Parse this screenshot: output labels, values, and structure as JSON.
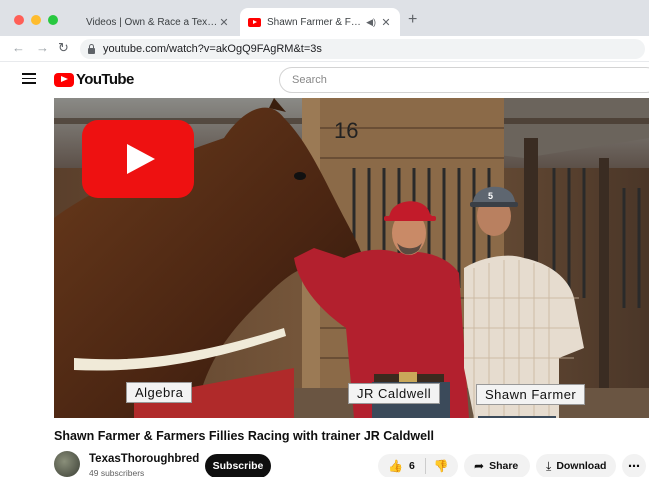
{
  "browser": {
    "tabs": [
      {
        "title": "Videos | Own & Race a Texas T",
        "active": false
      },
      {
        "title": "Shawn Farmer & Farmers F",
        "active": true
      }
    ],
    "address": "youtube.com/watch?v=akOgQ9FAgRM&t=3s"
  },
  "youtube": {
    "logo_text": "YouTube",
    "search_placeholder": "Search"
  },
  "video": {
    "stall_number": "16",
    "captions": {
      "left": "Algebra",
      "middle": "JR Caldwell",
      "right": "Shawn Farmer"
    },
    "cap_badge_number": "5",
    "title": "Shawn Farmer & Farmers Fillies Racing with trainer JR Caldwell"
  },
  "channel": {
    "name": "TexasThoroughbred",
    "subscribers": "49 subscribers",
    "subscribe_label": "Subscribe"
  },
  "actions": {
    "likes": "6",
    "share_label": "Share",
    "download_label": "Download"
  },
  "colors": {
    "brand_red": "#ff0000",
    "subscribe_bg": "#0f0f0f"
  }
}
